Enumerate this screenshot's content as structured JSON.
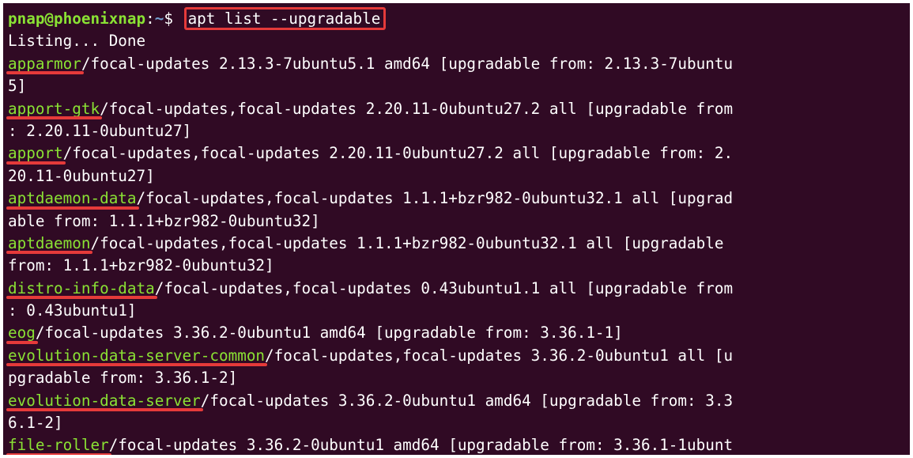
{
  "prompt": {
    "user_host": "pnap@phoenixnap",
    "sep": ":",
    "path": "~",
    "dollar": "$ ",
    "command": "apt list --upgradable"
  },
  "status_line": "Listing... Done",
  "lines": [
    {
      "pkg": "apparmor",
      "rest": "/focal-updates 2.13.3-7ubuntu5.1 amd64 [upgradable from: 2.13.3-7ubuntu"
    },
    {
      "pkg": "",
      "rest": "5]"
    },
    {
      "pkg": "apport-gtk",
      "rest": "/focal-updates,focal-updates 2.20.11-0ubuntu27.2 all [upgradable from"
    },
    {
      "pkg": "",
      "rest": ": 2.20.11-0ubuntu27]"
    },
    {
      "pkg": "apport",
      "rest": "/focal-updates,focal-updates 2.20.11-0ubuntu27.2 all [upgradable from: 2."
    },
    {
      "pkg": "",
      "rest": "20.11-0ubuntu27]"
    },
    {
      "pkg": "aptdaemon-data",
      "rest": "/focal-updates,focal-updates 1.1.1+bzr982-0ubuntu32.1 all [upgrad"
    },
    {
      "pkg": "",
      "rest": "able from: 1.1.1+bzr982-0ubuntu32]"
    },
    {
      "pkg": "aptdaemon",
      "rest": "/focal-updates,focal-updates 1.1.1+bzr982-0ubuntu32.1 all [upgradable"
    },
    {
      "pkg": "",
      "rest": "from: 1.1.1+bzr982-0ubuntu32]"
    },
    {
      "pkg": "distro-info-data",
      "rest": "/focal-updates,focal-updates 0.43ubuntu1.1 all [upgradable from"
    },
    {
      "pkg": "",
      "rest": ": 0.43ubuntu1]"
    },
    {
      "pkg": "eog",
      "rest": "/focal-updates 3.36.2-0ubuntu1 amd64 [upgradable from: 3.36.1-1]"
    },
    {
      "pkg": "evolution-data-server-common",
      "rest": "/focal-updates,focal-updates 3.36.2-0ubuntu1 all [u"
    },
    {
      "pkg": "",
      "rest": "pgradable from: 3.36.1-2]"
    },
    {
      "pkg": "evolution-data-server",
      "rest": "/focal-updates 3.36.2-0ubuntu1 amd64 [upgradable from: 3.3"
    },
    {
      "pkg": "",
      "rest": "6.1-2]"
    },
    {
      "pkg": "file-roller",
      "rest": "/focal-updates 3.36.2-0ubuntu1 amd64 [upgradable from: 3.36.1-1ubunt"
    }
  ],
  "colors": {
    "background": "#300a24",
    "prompt_user": "#8ae234",
    "prompt_path": "#729fcf",
    "package_name": "#8ae234",
    "highlight": "#e53a3a"
  }
}
